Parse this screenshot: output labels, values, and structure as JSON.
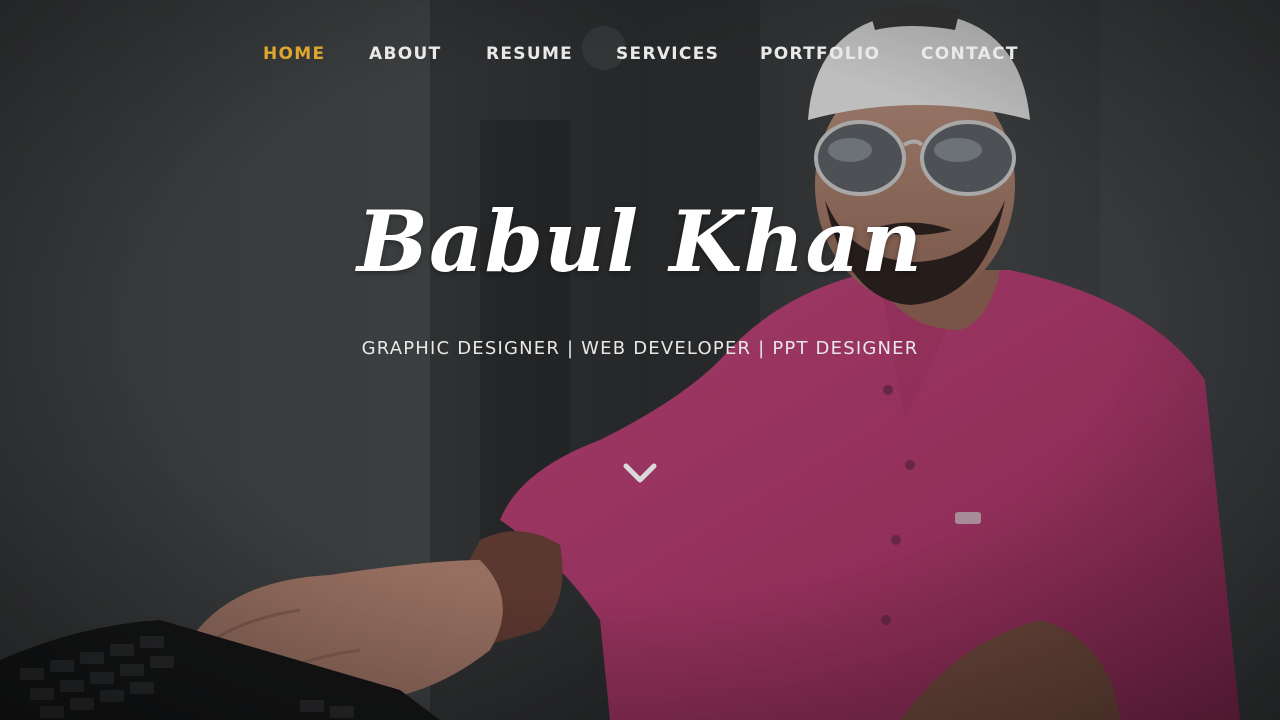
{
  "nav": {
    "items": [
      {
        "label": "HOME",
        "active": true
      },
      {
        "label": "ABOUT",
        "active": false
      },
      {
        "label": "RESUME",
        "active": false
      },
      {
        "label": "SERVICES",
        "active": false
      },
      {
        "label": "PORTFOLIO",
        "active": false
      },
      {
        "label": "CONTACT",
        "active": false
      }
    ]
  },
  "hero": {
    "name": "Babul Khan",
    "subtitle": "GRAPHIC DESIGNER | WEB DEVELOPER | PPT DESIGNER",
    "scroll_icon": "chevron-down-icon"
  },
  "colors": {
    "accent": "#e0a72e",
    "nav_text": "#e9e9e9",
    "shirt": "#b8396e"
  }
}
